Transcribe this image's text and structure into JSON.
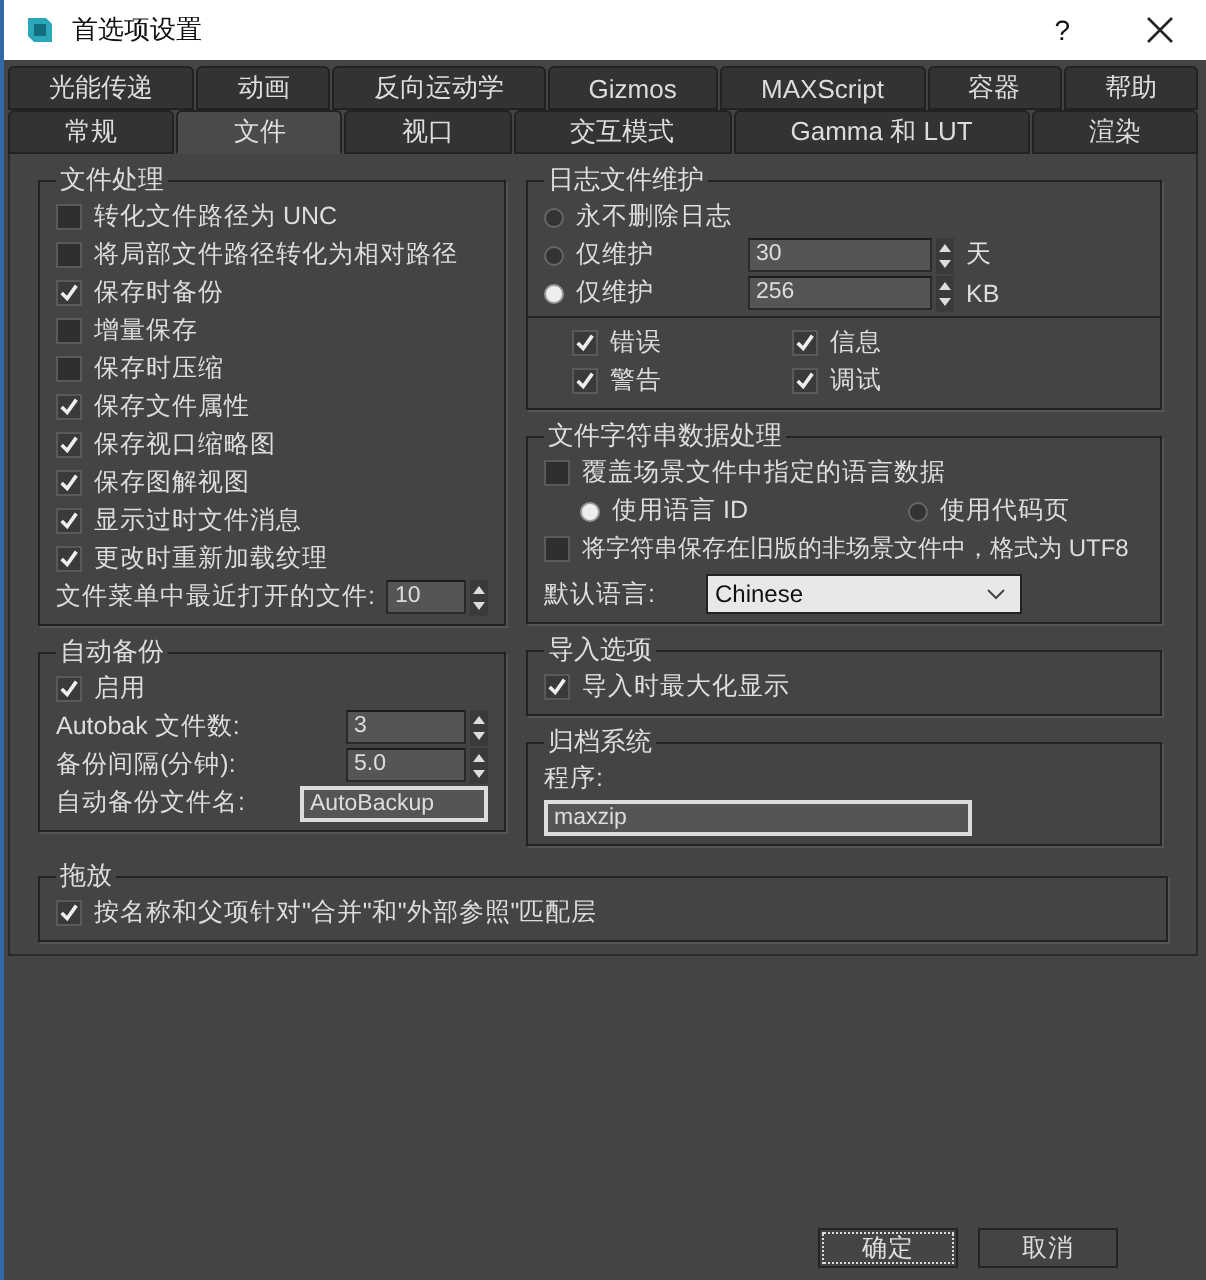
{
  "window": {
    "title": "首选项设置",
    "help": "?"
  },
  "tabs": {
    "row_1": [
      {
        "label": "光能传递",
        "selected": false
      },
      {
        "label": "动画",
        "selected": false
      },
      {
        "label": "反向运动学",
        "selected": false
      },
      {
        "label": "Gizmos",
        "selected": false
      },
      {
        "label": "MAXScript",
        "selected": false
      },
      {
        "label": "容器",
        "selected": false
      },
      {
        "label": "帮助",
        "selected": false
      }
    ],
    "row_2": [
      {
        "label": "常规",
        "selected": false
      },
      {
        "label": "文件",
        "selected": true
      },
      {
        "label": "视口",
        "selected": false
      },
      {
        "label": "交互模式",
        "selected": false
      },
      {
        "label": "Gamma 和 LUT",
        "selected": false
      },
      {
        "label": "渲染",
        "selected": false
      }
    ]
  },
  "file_handling": {
    "title": "文件处理",
    "options": [
      {
        "label": "转化文件路径为 UNC",
        "checked": false
      },
      {
        "label": "将局部文件路径转化为相对路径",
        "checked": false
      },
      {
        "label": "保存时备份",
        "checked": true
      },
      {
        "label": "增量保存",
        "checked": false
      },
      {
        "label": "保存时压缩",
        "checked": false
      },
      {
        "label": "保存文件属性",
        "checked": true
      },
      {
        "label": "保存视口缩略图",
        "checked": true
      },
      {
        "label": "保存图解视图",
        "checked": true
      },
      {
        "label": "显示过时文件消息",
        "checked": true
      },
      {
        "label": "更改时重新加载纹理",
        "checked": true
      }
    ],
    "recent_files": {
      "label": "文件菜单中最近打开的文件:",
      "value": "10"
    }
  },
  "auto_backup": {
    "title": "自动备份",
    "enabled": {
      "label": "启用",
      "checked": true
    },
    "fields": [
      {
        "kind": "spinner",
        "label": "Autobak 文件数:",
        "value": "3"
      },
      {
        "kind": "spinner",
        "label": "备份间隔(分钟):",
        "value": "5.0"
      },
      {
        "kind": "text",
        "label": "自动备份文件名:",
        "value": "AutoBackup"
      }
    ]
  },
  "log_maintenance": {
    "title": "日志文件维护",
    "modes": [
      {
        "label": "永不删除日志",
        "selected": false
      },
      {
        "label": "仅维护",
        "selected": false,
        "value": "30",
        "unit": "天"
      },
      {
        "label": "仅维护",
        "selected": true,
        "value": "256",
        "unit": "KB"
      }
    ],
    "levels": [
      {
        "label": "错误",
        "checked": true
      },
      {
        "label": "信息",
        "checked": true
      },
      {
        "label": "警告",
        "checked": true
      },
      {
        "label": "调试",
        "checked": true
      }
    ]
  },
  "string_data": {
    "title": "文件字符串数据处理",
    "override": {
      "label": "覆盖场景文件中指定的语言数据",
      "checked": false
    },
    "sources": [
      {
        "label": "使用语言 ID",
        "selected": true
      },
      {
        "label": "使用代码页",
        "selected": false
      }
    ],
    "save_utf8": {
      "label": "将字符串保存在旧版的非场景文件中，格式为 UTF8",
      "checked": false
    },
    "default_language": {
      "label": "默认语言:",
      "value": "Chinese"
    }
  },
  "import": {
    "title": "导入选项",
    "options": [
      {
        "label": "导入时最大化显示",
        "checked": true
      }
    ]
  },
  "archive": {
    "title": "归档系统",
    "program_label": "程序:",
    "program": "maxzip"
  },
  "drag_drop": {
    "title": "拖放",
    "options": [
      {
        "label": "按名称和父项针对\"合并\"和\"外部参照\"匹配层",
        "checked": true
      }
    ]
  },
  "buttons": [
    {
      "label": "确定",
      "focused": true
    },
    {
      "label": "取消",
      "focused": false
    }
  ]
}
